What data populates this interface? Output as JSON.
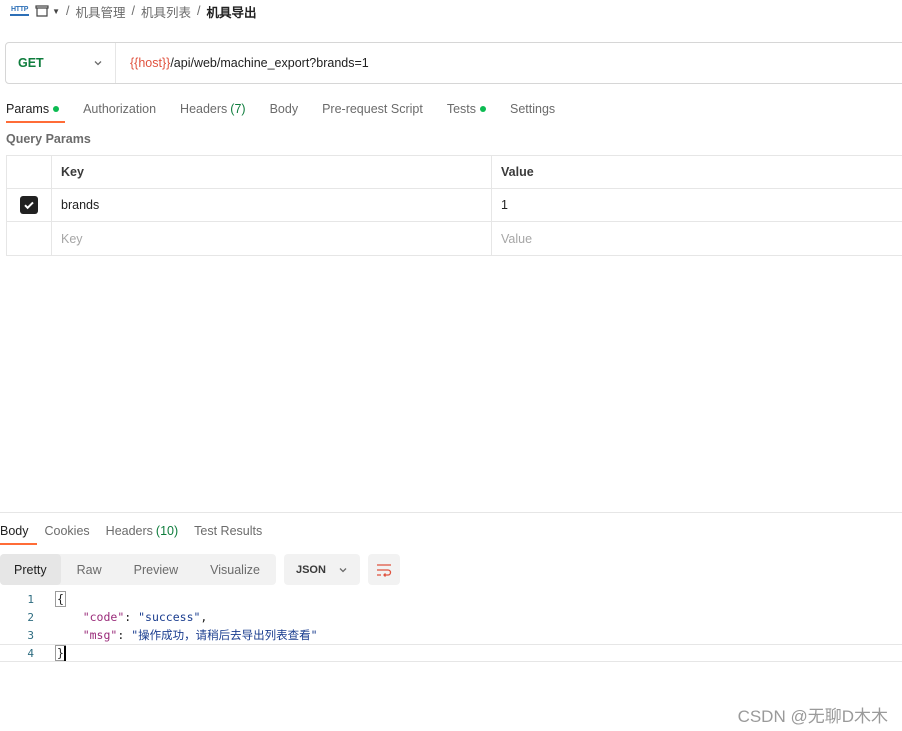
{
  "breadcrumb": {
    "http_icon": "HTTP",
    "items": [
      "机具管理",
      "机具列表",
      "机具导出"
    ],
    "separator": "/"
  },
  "request": {
    "method": "GET",
    "url_var": "{{host}}",
    "url_path": "/api/web/machine_export?brands=1"
  },
  "tabs": {
    "params": "Params",
    "authorization": "Authorization",
    "headers": "Headers",
    "headers_count": "(7)",
    "body": "Body",
    "prerequest": "Pre-request Script",
    "tests": "Tests",
    "settings": "Settings"
  },
  "query_params": {
    "title": "Query Params",
    "header_key": "Key",
    "header_value": "Value",
    "rows": [
      {
        "key": "brands",
        "value": "1",
        "checked": true
      }
    ],
    "placeholder_key": "Key",
    "placeholder_value": "Value"
  },
  "response": {
    "tabs": {
      "body": "Body",
      "cookies": "Cookies",
      "headers": "Headers",
      "headers_count": "(10)",
      "test_results": "Test Results"
    },
    "views": [
      "Pretty",
      "Raw",
      "Preview",
      "Visualize"
    ],
    "format": "JSON",
    "lines": {
      "n1": "1",
      "n2": "2",
      "n3": "3",
      "n4": "4",
      "open": "{",
      "close": "}",
      "code_key": "\"code\"",
      "code_val": "\"success\"",
      "msg_key": "\"msg\"",
      "msg_val": "\"操作成功，请稍后去导出列表查看\""
    }
  },
  "watermark": "CSDN @无聊D木木",
  "colors": {
    "accent": "#ff6c37",
    "method_get": "#0f7d3d",
    "url_var": "#e0523e",
    "status_dot": "#0cbb52"
  }
}
